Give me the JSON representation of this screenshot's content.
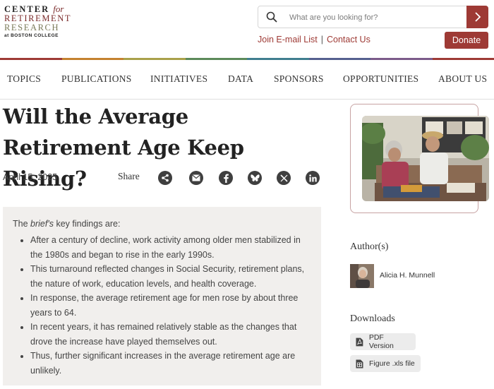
{
  "logo": {
    "line1": "CENTER",
    "line1_italic": "for",
    "line2": "RETIREMENT",
    "line3": "RESEARCH",
    "line4": "at BOSTON COLLEGE"
  },
  "search": {
    "placeholder": "What are you looking for?"
  },
  "header_links": {
    "email": "Join E-mail List",
    "separator": "|",
    "contact": "Contact Us",
    "donate": "Donate"
  },
  "nav": {
    "items": [
      "TOPICS",
      "PUBLICATIONS",
      "INITIATIVES",
      "DATA",
      "SPONSORS",
      "OPPORTUNITIES",
      "ABOUT US"
    ]
  },
  "article": {
    "title": "Will the Average Retirement Age Keep Rising?",
    "date": "April 15, 2025",
    "share_label": "Share"
  },
  "share_icons": [
    "share-icon",
    "email-icon",
    "facebook-icon",
    "bluesky-icon",
    "x-icon",
    "linkedin-icon"
  ],
  "findings": {
    "intro_before": "The ",
    "intro_italic": "brief's",
    "intro_after": " key findings are:",
    "items": [
      "After a century of decline, work activity among older men stabilized in the 1980s and began to rise in the early 1990s.",
      "This turnaround reflected changes in Social Security, retirement plans, the nature of work, education levels, and health coverage.",
      "In response, the average retirement age for men rose by about three years to 64.",
      "In recent years, it has remained relatively stable as the changes that drove the increase have played themselves out.",
      "Thus, further significant increases in the average retirement age are unlikely."
    ]
  },
  "sidebar": {
    "authors_heading": "Author(s)",
    "author_name": "Alicia H. Munnell",
    "downloads_heading": "Downloads",
    "downloads": [
      "PDF Version",
      "Figure .xls file"
    ]
  },
  "colors": {
    "brand": "#9e3a35",
    "findings_bg": "#f1efed",
    "colorbar": [
      "#9e3a35",
      "#c4822f",
      "#a9a14a",
      "#5c8a5a",
      "#3f7e8f",
      "#55608f",
      "#7b5b8a",
      "#9e3a35"
    ]
  }
}
